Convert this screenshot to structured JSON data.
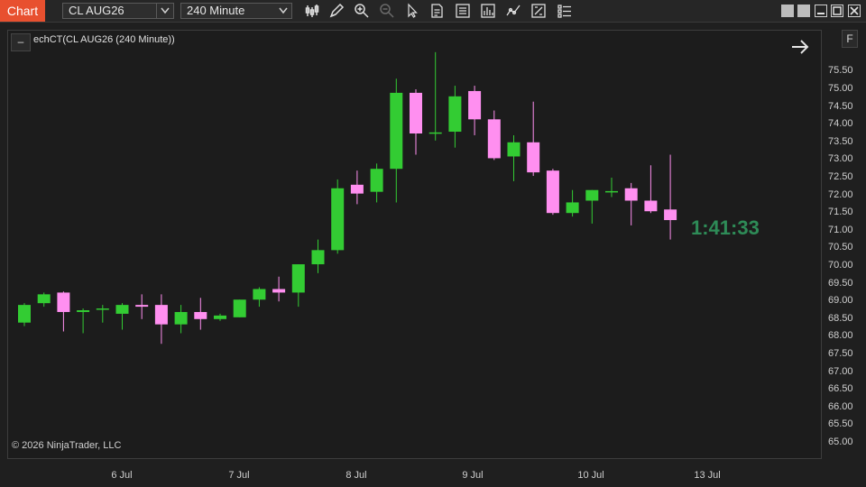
{
  "toolbar": {
    "tab_label": "Chart",
    "instrument": "CL AUG26",
    "interval": "240 Minute",
    "tools": [
      "bar-type-icon",
      "drawing-pencil-icon",
      "zoom-in-icon",
      "zoom-out-icon",
      "pointer-icon",
      "data-box-icon",
      "properties-icon",
      "strategies-icon",
      "indicators-icon",
      "templates-icon",
      "more-icon"
    ]
  },
  "chart": {
    "label": "echCT(CL AUG26 (240 Minute))",
    "collapse_label": "–",
    "f_label": "F",
    "timer": "1:41:33",
    "copyright": "© 2026 NinjaTrader, LLC",
    "up_color": "#33cc33",
    "down_color": "#ff8ff0"
  },
  "price_axis": [
    "75.50",
    "75.00",
    "74.50",
    "74.00",
    "73.50",
    "73.00",
    "72.50",
    "72.00",
    "71.50",
    "71.00",
    "70.50",
    "70.00",
    "69.50",
    "69.00",
    "68.50",
    "68.00",
    "67.50",
    "67.00",
    "66.50",
    "66.00",
    "65.50",
    "65.00"
  ],
  "time_axis": [
    "6 Jul",
    "7 Jul",
    "8 Jul",
    "9 Jul",
    "10 Jul",
    "13 Jul"
  ],
  "chart_data": {
    "type": "candlestick",
    "instrument": "CL AUG26",
    "interval": "240 Minute",
    "ylim": [
      64.7,
      76.1
    ],
    "candles": [
      {
        "o": 68.4,
        "h": 68.95,
        "l": 68.3,
        "c": 68.9
      },
      {
        "o": 68.95,
        "h": 69.25,
        "l": 68.85,
        "c": 69.2
      },
      {
        "o": 69.25,
        "h": 69.28,
        "l": 68.15,
        "c": 68.7
      },
      {
        "o": 68.7,
        "h": 68.8,
        "l": 68.1,
        "c": 68.75
      },
      {
        "o": 68.78,
        "h": 68.9,
        "l": 68.4,
        "c": 68.8
      },
      {
        "o": 68.65,
        "h": 68.95,
        "l": 68.2,
        "c": 68.9
      },
      {
        "o": 68.9,
        "h": 69.2,
        "l": 68.5,
        "c": 68.85
      },
      {
        "o": 68.9,
        "h": 69.2,
        "l": 67.8,
        "c": 68.35
      },
      {
        "o": 68.35,
        "h": 68.9,
        "l": 68.1,
        "c": 68.7
      },
      {
        "o": 68.7,
        "h": 69.1,
        "l": 68.2,
        "c": 68.5
      },
      {
        "o": 68.5,
        "h": 68.65,
        "l": 68.45,
        "c": 68.6
      },
      {
        "o": 68.55,
        "h": 69.05,
        "l": 68.55,
        "c": 69.05
      },
      {
        "o": 69.05,
        "h": 69.4,
        "l": 68.85,
        "c": 69.35
      },
      {
        "o": 69.35,
        "h": 69.7,
        "l": 69.0,
        "c": 69.25
      },
      {
        "o": 69.25,
        "h": 70.05,
        "l": 68.85,
        "c": 70.05
      },
      {
        "o": 70.05,
        "h": 70.75,
        "l": 69.8,
        "c": 70.45
      },
      {
        "o": 70.45,
        "h": 72.45,
        "l": 70.35,
        "c": 72.2
      },
      {
        "o": 72.3,
        "h": 72.7,
        "l": 71.75,
        "c": 72.05
      },
      {
        "o": 72.1,
        "h": 72.9,
        "l": 71.8,
        "c": 72.75
      },
      {
        "o": 72.75,
        "h": 75.3,
        "l": 71.8,
        "c": 74.9
      },
      {
        "o": 74.9,
        "h": 75.0,
        "l": 73.15,
        "c": 73.75
      },
      {
        "o": 73.75,
        "h": 76.05,
        "l": 73.55,
        "c": 73.78
      },
      {
        "o": 73.8,
        "h": 75.1,
        "l": 73.35,
        "c": 74.8
      },
      {
        "o": 74.95,
        "h": 75.1,
        "l": 73.7,
        "c": 74.15
      },
      {
        "o": 74.15,
        "h": 74.4,
        "l": 73.0,
        "c": 73.05
      },
      {
        "o": 73.1,
        "h": 73.7,
        "l": 72.4,
        "c": 73.5
      },
      {
        "o": 73.5,
        "h": 74.65,
        "l": 72.55,
        "c": 72.65
      },
      {
        "o": 72.7,
        "h": 72.75,
        "l": 71.45,
        "c": 71.5
      },
      {
        "o": 71.5,
        "h": 72.15,
        "l": 71.4,
        "c": 71.8
      },
      {
        "o": 71.85,
        "h": 72.15,
        "l": 71.2,
        "c": 72.15
      },
      {
        "o": 72.1,
        "h": 72.5,
        "l": 71.95,
        "c": 72.12
      },
      {
        "o": 72.2,
        "h": 72.35,
        "l": 71.15,
        "c": 71.85
      },
      {
        "o": 71.85,
        "h": 72.85,
        "l": 71.5,
        "c": 71.55
      },
      {
        "o": 71.6,
        "h": 73.15,
        "l": 70.75,
        "c": 71.3
      }
    ]
  }
}
